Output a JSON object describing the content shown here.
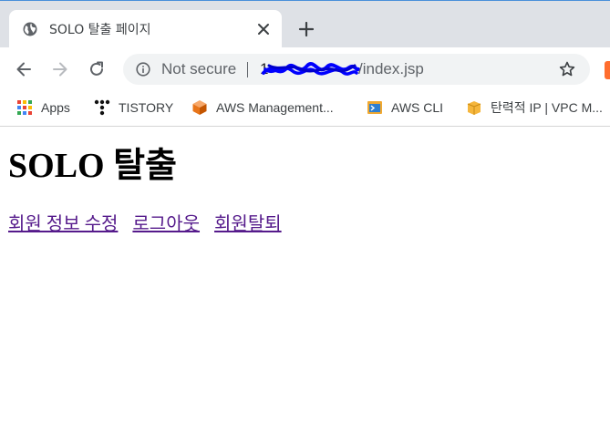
{
  "browser": {
    "tab": {
      "title": "SOLO 탈출 페이지",
      "favicon": "globe-icon"
    },
    "address_bar": {
      "security_label": "Not secure",
      "url_visible_prefix": "1",
      "url_path": "/index.jsp",
      "redaction_color": "#0000ff"
    },
    "bookmarks": [
      {
        "label": "Apps",
        "icon": "apps-grid-icon"
      },
      {
        "label": "TISTORY",
        "icon": "tistory-icon"
      },
      {
        "label": "AWS Management...",
        "icon": "aws-cube-icon"
      },
      {
        "label": "AWS CLI",
        "icon": "aws-cli-icon"
      },
      {
        "label": "탄력적 IP | VPC M...",
        "icon": "aws-package-icon"
      }
    ]
  },
  "page": {
    "heading": "SOLO 탈출",
    "links": [
      "회원 정보 수정",
      "로그아웃",
      "회원탈퇴"
    ],
    "link_color": "#551a8b"
  }
}
